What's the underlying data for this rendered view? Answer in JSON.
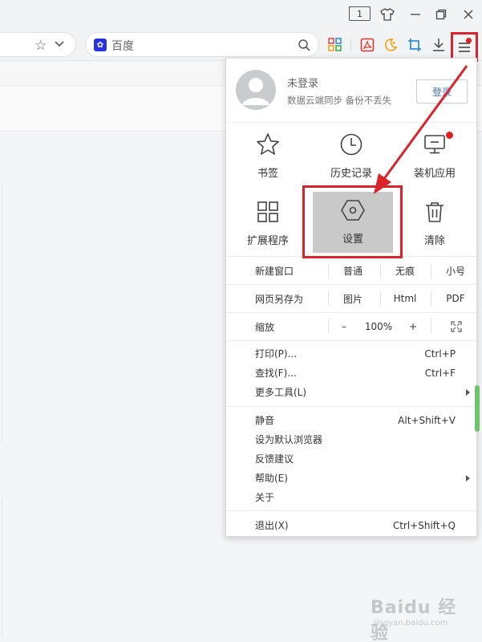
{
  "titlebar": {
    "tab_count": "1"
  },
  "search": {
    "engine": "百度"
  },
  "menu": {
    "user": {
      "name": "未登录",
      "desc": "数据云端同步 备份不丢失",
      "login": "登录"
    },
    "grid": [
      {
        "label": "书签",
        "icon": "star-icon"
      },
      {
        "label": "历史记录",
        "icon": "clock-icon"
      },
      {
        "label": "装机应用",
        "icon": "monitor-icon"
      },
      {
        "label": "扩展程序",
        "icon": "grid-icon"
      },
      {
        "label": "设置",
        "icon": "hexagon-icon"
      },
      {
        "label": "清除",
        "icon": "trash-icon"
      }
    ],
    "new_window": {
      "label": "新建窗口",
      "opt1": "普通",
      "opt2": "无痕",
      "opt3": "小号"
    },
    "save_as": {
      "label": "网页另存为",
      "opt1": "图片",
      "opt2": "Html",
      "opt3": "PDF"
    },
    "zoom": {
      "label": "缩放",
      "minus": "–",
      "value": "100%",
      "plus": "+"
    },
    "items_a": [
      {
        "label": "打印(P)...",
        "shortcut": "Ctrl+P"
      },
      {
        "label": "查找(F)...",
        "shortcut": "Ctrl+F"
      },
      {
        "label": "更多工具(L)",
        "shortcut": ""
      }
    ],
    "items_b": [
      {
        "label": "静音",
        "shortcut": "Alt+Shift+V"
      },
      {
        "label": "设为默认浏览器",
        "shortcut": ""
      },
      {
        "label": "反馈建议",
        "shortcut": ""
      },
      {
        "label": "帮助(E)",
        "shortcut": ""
      },
      {
        "label": "关于",
        "shortcut": ""
      }
    ],
    "exit": {
      "label": "退出(X)",
      "shortcut": "Ctrl+Shift+Q"
    }
  },
  "colors": {
    "highlight": "#d9242c",
    "link": "#3a6fc7"
  },
  "watermark": {
    "brand": "Baidu 经验",
    "url": "jingyan.baidu.com"
  }
}
